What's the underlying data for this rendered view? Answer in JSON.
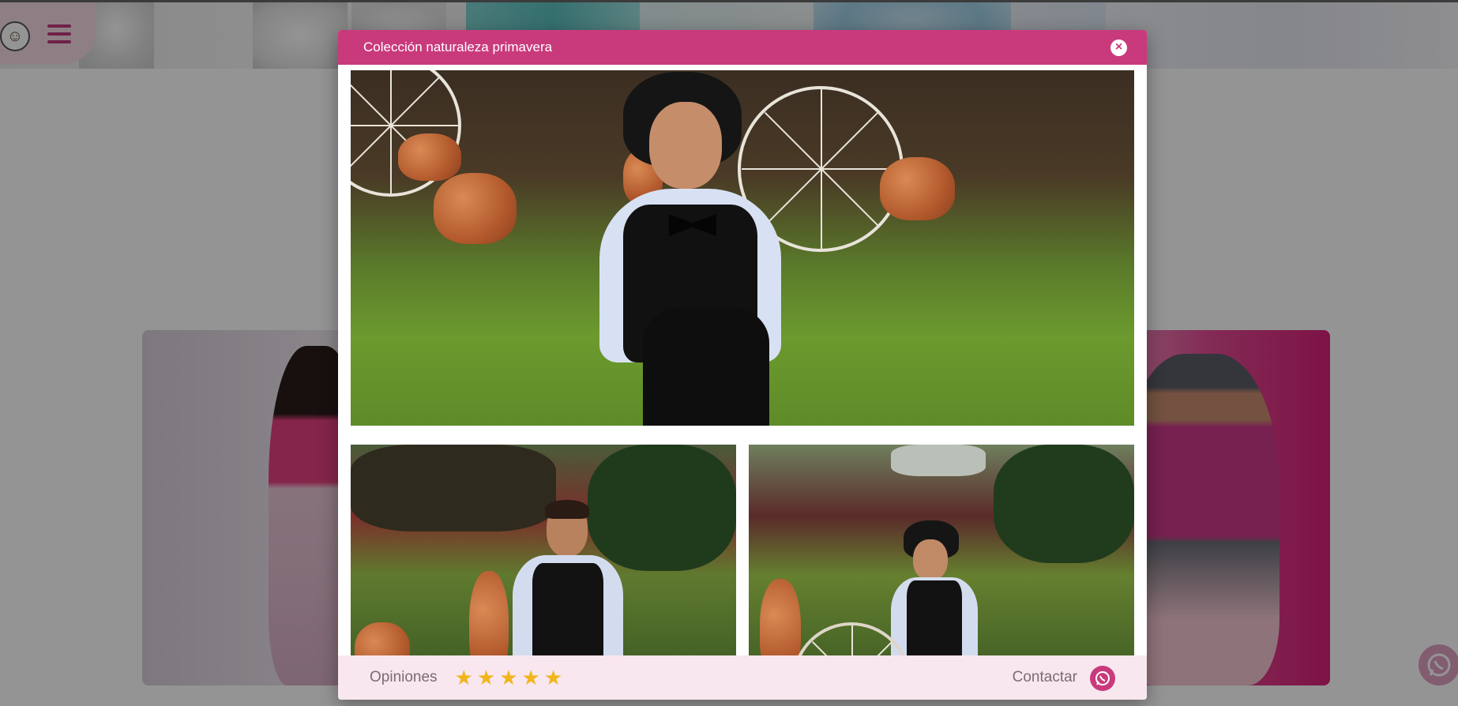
{
  "modal": {
    "title": "Colección naturaleza primavera",
    "close_icon": "close-icon",
    "gallery": [
      {
        "name": "main-photo",
        "description_icon": "photo"
      },
      {
        "name": "photo-left"
      },
      {
        "name": "photo-right"
      }
    ],
    "footer": {
      "opinions_label": "Opiniones",
      "rating": 5,
      "contact_label": "Contactar",
      "whatsapp_icon": "whatsapp-icon"
    }
  },
  "colors": {
    "brand": "#c93a7c",
    "footer_bg": "#f8e7ee",
    "star": "#f1b51c"
  }
}
